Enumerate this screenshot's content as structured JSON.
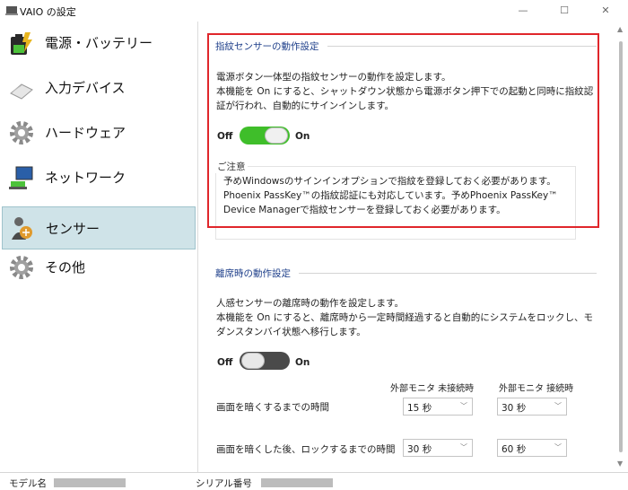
{
  "window": {
    "title": "VAIO の設定",
    "minimize": "—",
    "maximize": "☐",
    "close": "✕"
  },
  "sidebar": {
    "items": [
      {
        "label": "電源・バッテリー",
        "icon": "battery-icon"
      },
      {
        "label": "入力デバイス",
        "icon": "mouse-icon"
      },
      {
        "label": "ハードウェア",
        "icon": "gear-icon"
      },
      {
        "label": "ネットワーク",
        "icon": "network-icon"
      },
      {
        "label": "センサー",
        "icon": "sensor-icon",
        "active": true
      },
      {
        "label": "その他",
        "icon": "gear-icon"
      }
    ]
  },
  "fingerprint": {
    "title": "指紋センサーの動作設定",
    "desc_line1": "電源ボタン一体型の指紋センサーの動作を設定します。",
    "desc_line2": "本機能を On にすると、シャットダウン状態から電源ボタン押下での起動と同時に指紋認",
    "desc_line3": "証が行われ、自動的にサインインします。",
    "toggle_off": "Off",
    "toggle_on": "On",
    "toggle_state": "on",
    "note_title": "ご注意",
    "note_line1": "予めWindowsのサインインオプションで指紋を登録しておく必要があります。",
    "note_line2": "Phoenix PassKey™の指紋認証にも対応しています。予めPhoenix PassKey™",
    "note_line3": "Device Managerで指紋センサーを登録しておく必要があります。"
  },
  "away": {
    "title": "離席時の動作設定",
    "desc_line1": "人感センサーの離席時の動作を設定します。",
    "desc_line2": "本機能を On にすると、離席時から一定時間経過すると自動的にシステムをロックし、モ",
    "desc_line3": "ダンスタンバイ状態へ移行します。",
    "toggle_off": "Off",
    "toggle_on": "On",
    "toggle_state": "off",
    "col_disconnected": "外部モニタ 未接続時",
    "col_connected": "外部モニタ 接続時",
    "rows": [
      {
        "label": "画面を暗くするまでの時間",
        "disconnected": "15 秒",
        "connected": "30 秒"
      },
      {
        "label": "画面を暗くした後、ロックするまでの時間",
        "disconnected": "30 秒",
        "connected": "60 秒"
      }
    ]
  },
  "status": {
    "model_label": "モデル名",
    "serial_label": "シリアル番号"
  },
  "colors": {
    "highlight": "#e0262b",
    "toggle_on": "#3fbe2a",
    "toggle_off": "#4a4a4a",
    "section_title": "#1e3f8a"
  }
}
